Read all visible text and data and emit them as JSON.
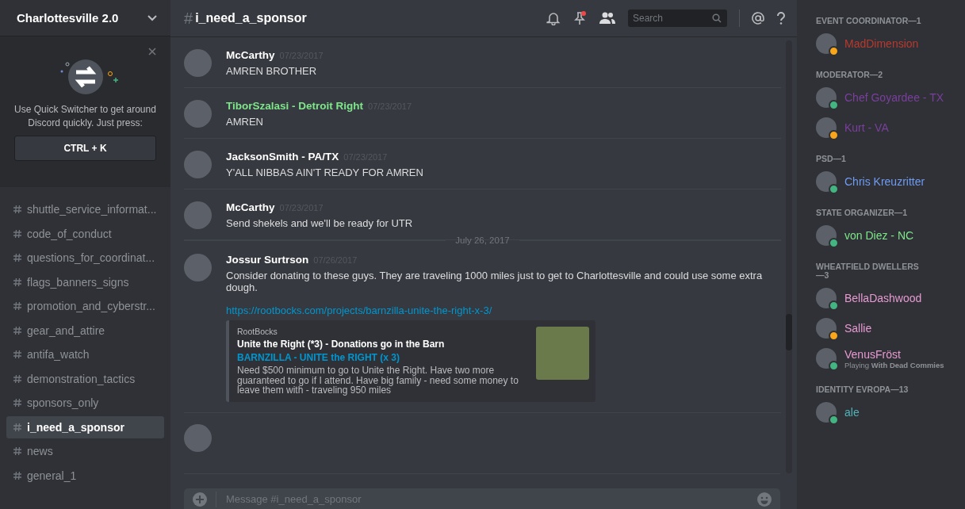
{
  "server": {
    "name": "Charlottesville 2.0"
  },
  "quick_switcher": {
    "text": "Use Quick Switcher to get around Discord quickly. Just press:",
    "shortcut": "CTRL + K"
  },
  "channels": [
    {
      "name": "shuttle_service_informat...",
      "selected": false
    },
    {
      "name": "code_of_conduct",
      "selected": false
    },
    {
      "name": "questions_for_coordinat...",
      "selected": false
    },
    {
      "name": "flags_banners_signs",
      "selected": false
    },
    {
      "name": "promotion_and_cyberstr...",
      "selected": false
    },
    {
      "name": "gear_and_attire",
      "selected": false
    },
    {
      "name": "antifa_watch",
      "selected": false
    },
    {
      "name": "demonstration_tactics",
      "selected": false
    },
    {
      "name": "sponsors_only",
      "selected": false
    },
    {
      "name": "i_need_a_sponsor",
      "selected": true
    },
    {
      "name": "news",
      "selected": false
    },
    {
      "name": "general_1",
      "selected": false
    }
  ],
  "header": {
    "hash": "#",
    "channel": "i_need_a_sponsor",
    "search_placeholder": "Search",
    "pins_unread": true
  },
  "messages": [
    {
      "kind": "message",
      "author": "McCarthy",
      "color": "#ffffff",
      "timestamp": "07/23/2017",
      "lines": [
        "AMREN BROTHER"
      ]
    },
    {
      "kind": "message",
      "author": "TiborSzalasi - Detroit Right",
      "color": "#7ee68a",
      "timestamp": "07/23/2017",
      "lines": [
        "AMREN"
      ]
    },
    {
      "kind": "message",
      "author": "JacksonSmith - PA/TX",
      "color": "#ffffff",
      "timestamp": "07/23/2017",
      "lines": [
        "Y'ALL NIBBAS AIN'T READY FOR AMREN"
      ]
    },
    {
      "kind": "message",
      "author": "McCarthy",
      "color": "#ffffff",
      "timestamp": "07/23/2017",
      "lines": [
        "Send shekels and we'll be ready for UTR"
      ]
    },
    {
      "kind": "divider",
      "label": "July 26, 2017"
    },
    {
      "kind": "message",
      "author": "Jossur Surtrson",
      "color": "#ffffff",
      "timestamp": "07/26/2017",
      "lines": [
        "Consider donating to these guys. They are traveling 1000 miles just to get to Charlottesville and could use some extra dough."
      ],
      "link": "https://rootbocks.com/projects/barnzilla-unite-the-right-x-3/",
      "embed": {
        "provider": "RootBocks",
        "title": "Unite the Right (*3) - Donations go in the Barn",
        "subtitle": "BARNZILLA - UNITE the RIGHT (x 3)",
        "description": "Need $500 minimum to go to Unite the Right. Have two more guaranteed to go if I attend. Have big family - need some money to leave them with - traveling 950 miles"
      }
    }
  ],
  "composer": {
    "placeholder": "Message #i_need_a_sponsor"
  },
  "member_groups": [
    {
      "title": "EVENT COORDINATOR—1",
      "members": [
        {
          "name": "MadDimension",
          "color": "#b83a2e",
          "idle": true
        }
      ]
    },
    {
      "title": "MODERATOR—2",
      "members": [
        {
          "name": "Chef Goyardee - TX",
          "color": "#7b3f9e",
          "idle": false
        },
        {
          "name": "Kurt - VA",
          "color": "#7b3f9e",
          "idle": true
        }
      ]
    },
    {
      "title": "PSD—1",
      "members": [
        {
          "name": "Chris Kreuzritter",
          "color": "#6f9bf0",
          "idle": false
        }
      ]
    },
    {
      "title": "STATE ORGANIZER—1",
      "members": [
        {
          "name": "von Diez - NC",
          "color": "#7ee68a",
          "idle": false
        }
      ]
    },
    {
      "title": "WHEATFIELD DWELLERS—3",
      "members": [
        {
          "name": "BellaDashwood",
          "color": "#e89ad2",
          "idle": false
        },
        {
          "name": "Sallie",
          "color": "#e89ad2",
          "idle": true
        },
        {
          "name": "VenusFröst",
          "color": "#e89ad2",
          "idle": false,
          "activity": "Playing",
          "game": "With Dead Commies"
        }
      ]
    },
    {
      "title": "IDENTITY EVROPA—13",
      "members": [
        {
          "name": "ale",
          "color": "#4fb3b8",
          "idle": false
        }
      ]
    }
  ]
}
